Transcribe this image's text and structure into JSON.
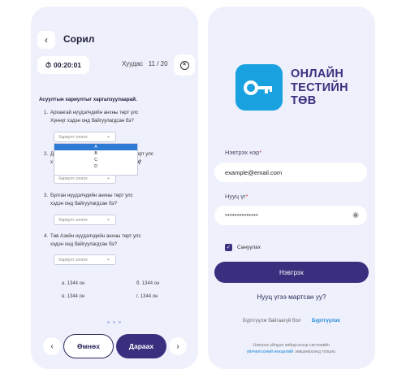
{
  "quiz": {
    "title": "Сорил",
    "timer": "00:20:01",
    "counter_label": "Хуудас",
    "counter_value": "11 / 20",
    "instruction": "Асуултын хариултыг харгалзуулаарай.",
    "questions": [
      {
        "number": "1.",
        "line1": "Архангай нүүдэлчдийн анхны төрт улс",
        "line2": "Хүннүг хэдэн онд байгуулагдсан бэ?",
        "select": "Хариулт сонгох"
      },
      {
        "number": "2.",
        "line1": "Д",
        "line1_tail": "ны төрт улс Хүннү",
        "line2": "х",
        "line2_tail": "эн бэ?",
        "select": "Хариулт сонгох"
      },
      {
        "number": "3.",
        "line1": "Булган нүүдэлчдийн анхны төрт улс",
        "line2": "хэдэн онд байгуулагдсан бэ?",
        "select": "Хариулт сонгох"
      },
      {
        "number": "4.",
        "line1": "Төв Азийн нүүдэлчдийн анхны төрт улс",
        "line2": "хэдэн онд байгуулагдсан бэ?",
        "select": "Хариулт сонгох"
      }
    ],
    "dropdown_options": [
      "A",
      "B",
      "C",
      "D"
    ],
    "answers": [
      {
        "label": "а. 1344 он"
      },
      {
        "label": "б. 1344 он"
      },
      {
        "label": "в. 1344 он"
      },
      {
        "label": "г. 1344 он"
      }
    ],
    "prev_label": "Өмнөх",
    "next_label": "Дараах"
  },
  "login": {
    "brand_lines": [
      "ОНЛАЙН",
      "ТЕСТИЙН",
      "ТӨВ"
    ],
    "username_label": "Нэвтрэх нэр",
    "username_value": "example@email.com",
    "password_label": "Нууц үг",
    "password_value": "**************",
    "remember_label": "Сануулах",
    "login_button": "Нэвтрэх",
    "forgot_link": "Нууц үгээ мартсан уу?",
    "no_account_text": "Бүртгүүлж байгаагүй бол",
    "register_link": "Бүртгүүлэх",
    "terms_line1": "Нэвтрэх үйлдэл хийгдсэнээр системийн",
    "terms_link": "үйлчилгээний нөхцөлийг",
    "terms_line2_tail": "зөвшөөрсөнд тооцно.",
    "colors": {
      "accent": "#3a2f7e",
      "logo": "#1aa1df",
      "link": "#1a86d6"
    }
  }
}
